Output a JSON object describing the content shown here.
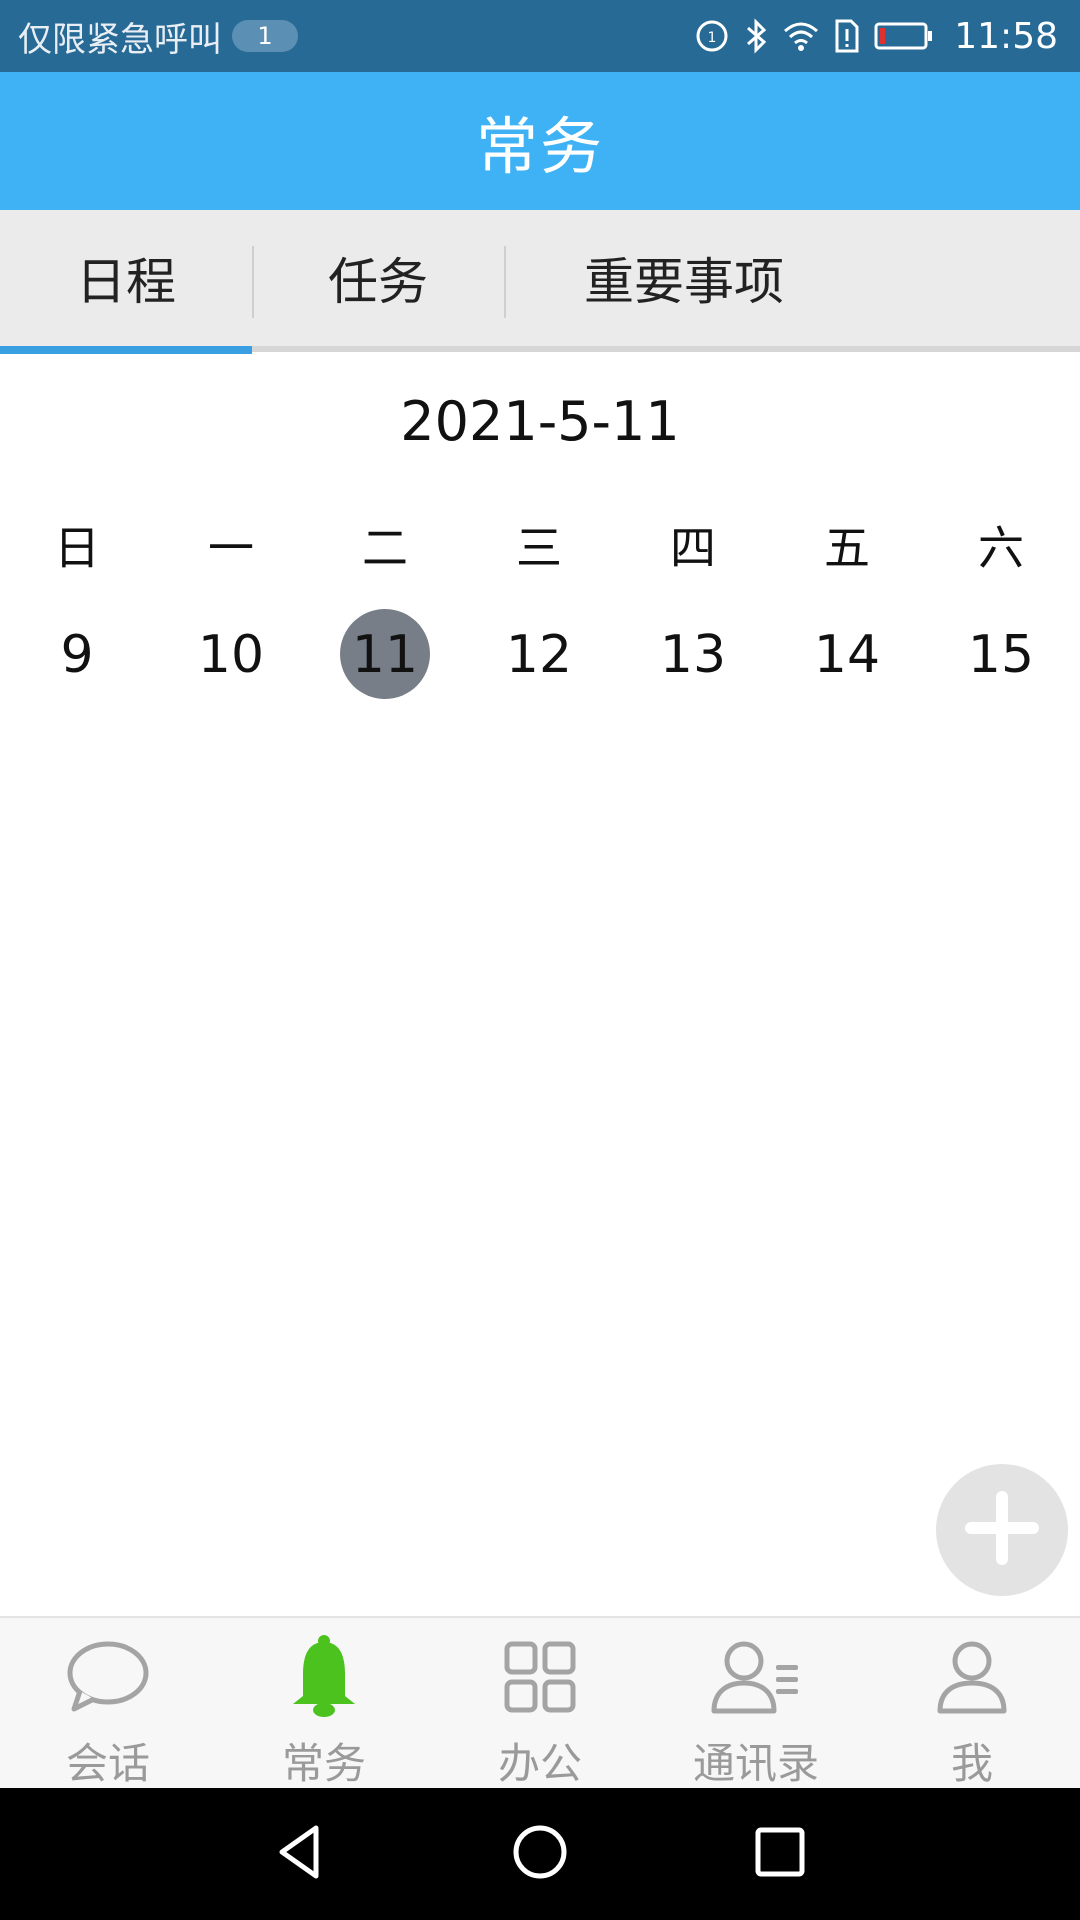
{
  "status_bar": {
    "carrier_text": "仅限紧急呼叫",
    "notification_count": "1",
    "time": "11:58",
    "icons": [
      "data-saver-icon",
      "bluetooth-icon",
      "wifi-icon",
      "sim-alert-icon",
      "battery-low-icon"
    ]
  },
  "header": {
    "title": "常务"
  },
  "tabs": [
    {
      "label": "日程",
      "active": true
    },
    {
      "label": "任务",
      "active": false
    },
    {
      "label": "重要事项",
      "active": false
    }
  ],
  "calendar": {
    "date_label": "2021-5-11",
    "weekdays": [
      "日",
      "一",
      "二",
      "三",
      "四",
      "五",
      "六"
    ],
    "days": [
      "9",
      "10",
      "11",
      "12",
      "13",
      "14",
      "15"
    ],
    "selected_day": "11"
  },
  "fab": {
    "icon": "plus-icon"
  },
  "bottom_nav": [
    {
      "label": "会话",
      "icon": "chat-bubble-icon",
      "active": false
    },
    {
      "label": "常务",
      "icon": "bell-icon",
      "active": true
    },
    {
      "label": "办公",
      "icon": "grid-icon",
      "active": false
    },
    {
      "label": "通讯录",
      "icon": "contacts-icon",
      "active": false
    },
    {
      "label": "我",
      "icon": "person-icon",
      "active": false
    }
  ],
  "colors": {
    "status_bar": "#276a96",
    "header": "#3eb2f4",
    "tab_indicator": "#3a9fe0",
    "selected_day": "#787e87",
    "active_nav_icon": "#4cc21f",
    "inactive_nav": "#9a9a9a"
  },
  "system_nav": [
    "back-icon",
    "home-icon",
    "recents-icon"
  ]
}
